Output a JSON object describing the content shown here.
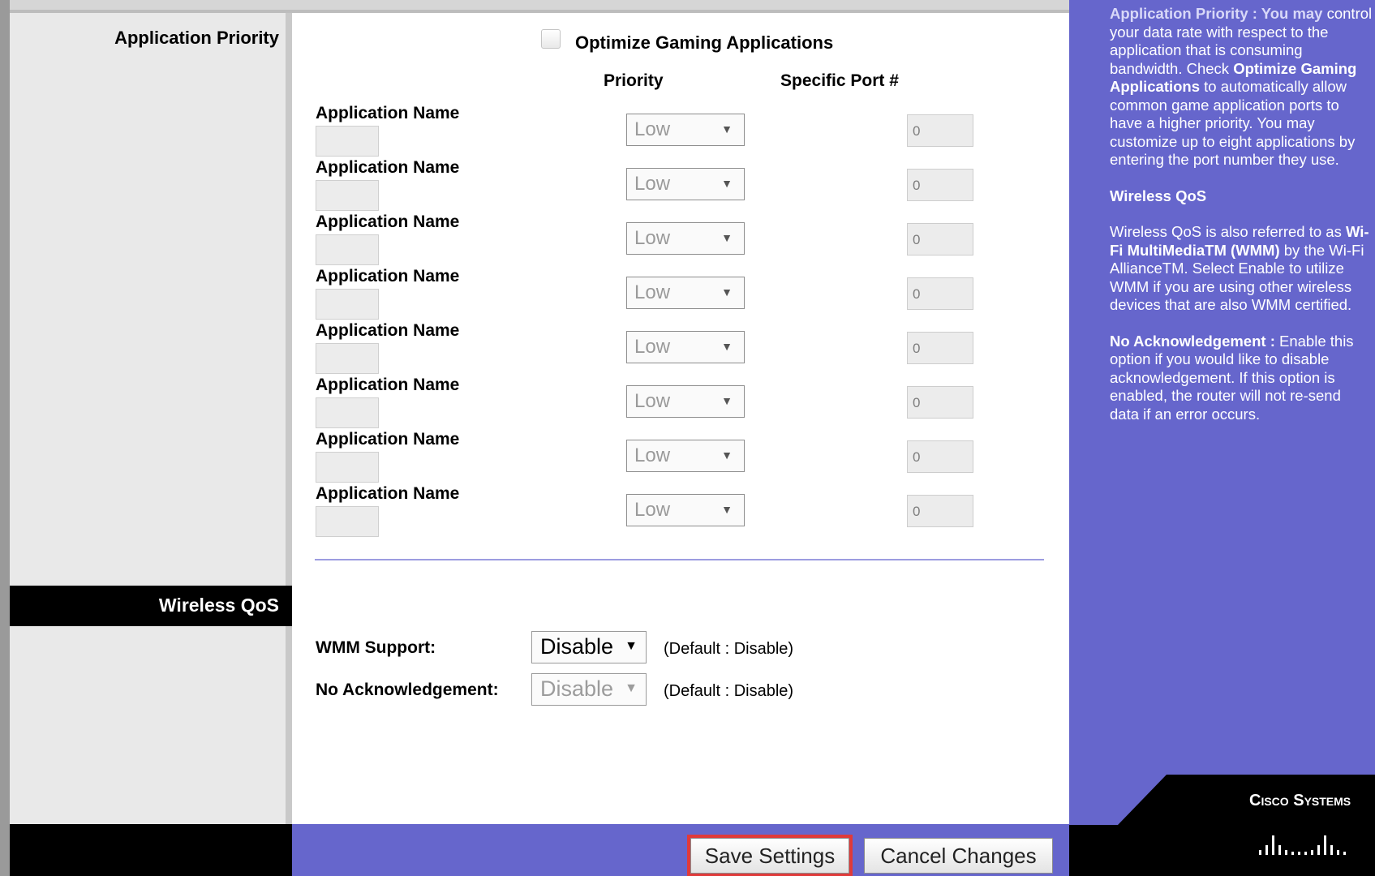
{
  "left": {
    "app_priority_label": "Application Priority",
    "wireless_qos_label": "Wireless QoS"
  },
  "app_priority": {
    "optimize_label": "Optimize Gaming Applications",
    "optimize_checked": false,
    "col_priority": "Priority",
    "col_port": "Specific Port #",
    "rows": [
      {
        "name_label": "Application Name",
        "name_value": "",
        "priority": "Low",
        "port": "0"
      },
      {
        "name_label": "Application Name",
        "name_value": "",
        "priority": "Low",
        "port": "0"
      },
      {
        "name_label": "Application Name",
        "name_value": "",
        "priority": "Low",
        "port": "0"
      },
      {
        "name_label": "Application Name",
        "name_value": "",
        "priority": "Low",
        "port": "0"
      },
      {
        "name_label": "Application Name",
        "name_value": "",
        "priority": "Low",
        "port": "0"
      },
      {
        "name_label": "Application Name",
        "name_value": "",
        "priority": "Low",
        "port": "0"
      },
      {
        "name_label": "Application Name",
        "name_value": "",
        "priority": "Low",
        "port": "0"
      },
      {
        "name_label": "Application Name",
        "name_value": "",
        "priority": "Low",
        "port": "0"
      }
    ]
  },
  "wireless_qos": {
    "wmm_label": "WMM Support:",
    "wmm_value": "Disable",
    "wmm_default": "(Default : Disable)",
    "noack_label": "No Acknowledgement:",
    "noack_value": "Disable",
    "noack_default": "(Default : Disable)"
  },
  "buttons": {
    "save": "Save Settings",
    "cancel": "Cancel Changes"
  },
  "help": {
    "p1_title": "Application Priority : You may",
    "p1_body": "control your data rate with respect to the application that is consuming bandwidth. Check",
    "p1_bold": "Optimize Gaming Applications",
    "p1_tail": "to automatically allow common game application ports to have a higher priority. You may customize up to eight applications by entering the port number they use.",
    "p2_title": "Wireless QoS",
    "p3_pre": "Wireless QoS is also referred to as",
    "p3_bold": "Wi-Fi MultiMediaTM (WMM)",
    "p3_tail": "by the Wi-Fi AllianceTM. Select Enable to utilize WMM if you are using other wireless devices that are also WMM certified.",
    "p4_title": "No Acknowledgement :",
    "p4_body": "Enable this option if you would like to disable acknowledgement. If this option is enabled, the router will not re-send data if an error occurs."
  },
  "brand": {
    "name": "Cisco Systems",
    "logo_icon": "cisco-bars-logo"
  },
  "colors": {
    "accent_purple": "#6666cc",
    "highlight_red": "#e03a3a"
  }
}
